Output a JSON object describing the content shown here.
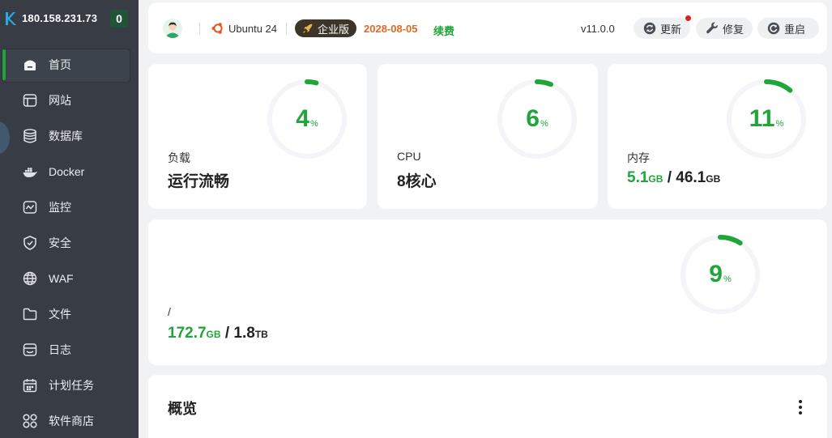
{
  "sidebar": {
    "ip": "180.158.231.73",
    "count": "0",
    "items": [
      {
        "label": "首页",
        "icon": "home-icon"
      },
      {
        "label": "网站",
        "icon": "globe-window-icon"
      },
      {
        "label": "数据库",
        "icon": "database-icon"
      },
      {
        "label": "Docker",
        "icon": "docker-icon"
      },
      {
        "label": "监控",
        "icon": "monitor-icon"
      },
      {
        "label": "安全",
        "icon": "shield-icon"
      },
      {
        "label": "WAF",
        "icon": "waf-globe-icon"
      },
      {
        "label": "文件",
        "icon": "folder-icon"
      },
      {
        "label": "日志",
        "icon": "log-icon"
      },
      {
        "label": "计划任务",
        "icon": "calendar-icon"
      },
      {
        "label": "软件商店",
        "icon": "apps-icon"
      }
    ]
  },
  "topbar": {
    "os": "Ubuntu 24",
    "edition": "企业版",
    "expire_date": "2028-08-05",
    "renew": "续费",
    "version": "v11.0.0",
    "update": "更新",
    "repair": "修复",
    "restart": "重启"
  },
  "stats": {
    "load": {
      "label": "负载",
      "value": "运行流畅",
      "percent": 4
    },
    "cpu": {
      "label": "CPU",
      "value": "8核心",
      "percent": 6
    },
    "memory": {
      "label": "内存",
      "used": "5.1",
      "used_unit": "GB",
      "sep": " / ",
      "total": "46.1",
      "total_unit": "GB",
      "percent": 11
    },
    "disk": {
      "label": "/",
      "used": "172.7",
      "used_unit": "GB",
      "sep": " / ",
      "total": "1.8",
      "total_unit": "TB",
      "percent": 9
    }
  },
  "overview": {
    "title": "概览"
  },
  "colors": {
    "accent": "#20a53a",
    "sidebar_bg": "#373c45",
    "orange": "#e06a22"
  }
}
